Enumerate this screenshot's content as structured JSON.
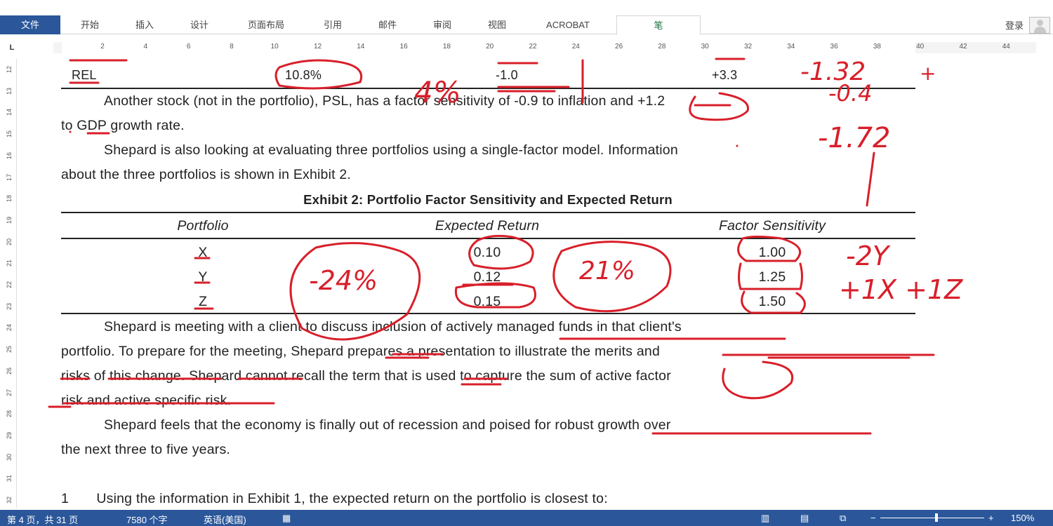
{
  "ribbon": {
    "tabs": [
      "文件",
      "开始",
      "插入",
      "设计",
      "页面布局",
      "引用",
      "邮件",
      "审阅",
      "视图",
      "ACROBAT",
      "笔"
    ],
    "active_tab": "笔",
    "login": "登录"
  },
  "ruler": {
    "corner": "L",
    "h_ticks": [
      "2",
      "4",
      "6",
      "8",
      "10",
      "12",
      "14",
      "16",
      "18",
      "20",
      "22",
      "24",
      "26",
      "28",
      "30",
      "32",
      "34",
      "36",
      "38",
      "40",
      "42",
      "44"
    ],
    "v_ticks": [
      "12",
      "13",
      "14",
      "15",
      "16",
      "17",
      "18",
      "19",
      "20",
      "21",
      "22",
      "23",
      "24",
      "25",
      "26",
      "27",
      "28",
      "29",
      "30",
      "31",
      "32"
    ]
  },
  "document": {
    "exhibit1_row": {
      "stock": "REL",
      "return": "10.8%",
      "inflation": "-1.0",
      "gdp": "+3.3"
    },
    "p1a": "Another stock (not in the portfolio), PSL, has a factor sensitivity of -0.9 to inflation and +1.2",
    "p1b": "to GDP growth rate.",
    "p2a": "Shepard is also looking at evaluating three portfolios using a single-factor model. Information",
    "p2b": "about the three portfolios is shown in Exhibit 2.",
    "exhibit2": {
      "title": "Exhibit 2: Portfolio Factor Sensitivity and Expected Return",
      "headers": [
        "Portfolio",
        "Expected Return",
        "Factor Sensitivity"
      ],
      "rows": [
        [
          "X",
          "0.10",
          "1.00"
        ],
        [
          "Y",
          "0.12",
          "1.25"
        ],
        [
          "Z",
          "0.15",
          "1.50"
        ]
      ]
    },
    "p3": [
      "Shepard is meeting with a client to discuss inclusion of actively managed funds in that client's",
      "portfolio. To prepare for the meeting, Shepard prepares a presentation to illustrate the merits and",
      "risks of this change. Shepard cannot recall the term that is used to capture the sum of active factor",
      "risk and active specific risk."
    ],
    "p4": [
      "Shepard feels that the economy is finally out of recession and poised for robust growth over",
      "the next three to five years."
    ],
    "q1": "1       Using the information in Exhibit 1, the expected return on the portfolio is closest to:"
  },
  "annotations": [
    "4%",
    "-1.32",
    "+",
    "-0.4",
    "-1.72",
    "-24%",
    "21%",
    "-2Y",
    "+1X +1Z"
  ],
  "status": {
    "page": "第 4 页，共 31 页",
    "words": "7580 个字",
    "language": "英语(美国)",
    "zoom": "150%"
  },
  "colors": {
    "accent": "#2b579a",
    "ink": "#d81f2a"
  }
}
